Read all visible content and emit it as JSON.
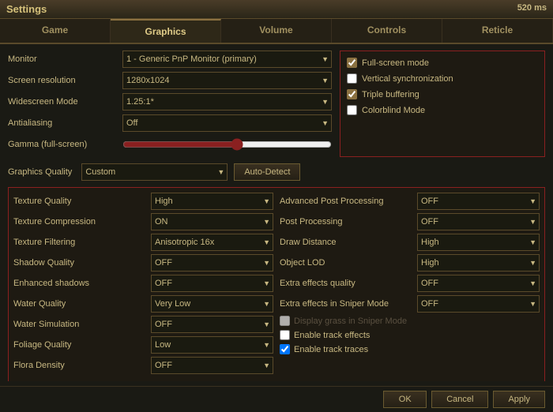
{
  "titleBar": {
    "label": "Settings"
  },
  "fpscounter": "520 ms",
  "tabs": [
    {
      "id": "game",
      "label": "Game",
      "active": false
    },
    {
      "id": "graphics",
      "label": "Graphics",
      "active": true
    },
    {
      "id": "volume",
      "label": "Volume",
      "active": false
    },
    {
      "id": "controls",
      "label": "Controls",
      "active": false
    },
    {
      "id": "reticle",
      "label": "Reticle",
      "active": false
    }
  ],
  "leftSettings": {
    "monitor": {
      "label": "Monitor",
      "value": "1 - Generic PnP Monitor (primary)"
    },
    "screenResolution": {
      "label": "Screen resolution",
      "value": "1280x1024"
    },
    "widescreenMode": {
      "label": "Widescreen Mode",
      "value": "1.25:1*"
    },
    "antialiasing": {
      "label": "Antialiasing",
      "value": "Off"
    },
    "gamma": {
      "label": "Gamma (full-screen)",
      "sliderValue": 55
    }
  },
  "rightPanel": {
    "fullScreenMode": {
      "label": "Full-screen mode",
      "checked": true
    },
    "verticalSync": {
      "label": "Vertical synchronization",
      "checked": false
    },
    "tripleBuffering": {
      "label": "Triple buffering",
      "checked": true
    },
    "colorblindMode": {
      "label": "Colorblind Mode",
      "checked": false
    }
  },
  "graphicsQuality": {
    "label": "Graphics Quality",
    "value": "Custom",
    "autoDetect": "Auto-Detect"
  },
  "bottomLeft": {
    "items": [
      {
        "label": "Texture Quality",
        "value": "High"
      },
      {
        "label": "Texture Compression",
        "value": "ON"
      },
      {
        "label": "Texture Filtering",
        "value": "Anisotropic 16x"
      },
      {
        "label": "Shadow Quality",
        "value": "OFF"
      },
      {
        "label": "Enhanced shadows",
        "value": "OFF"
      },
      {
        "label": "Water Quality",
        "value": "Very Low"
      },
      {
        "label": "Water Simulation",
        "value": "OFF"
      },
      {
        "label": "Foliage Quality",
        "value": "Low"
      },
      {
        "label": "Flora Density",
        "value": "OFF"
      }
    ]
  },
  "bottomRight": {
    "dropdownItems": [
      {
        "label": "Advanced Post Processing",
        "value": "OFF"
      },
      {
        "label": "Post Processing",
        "value": "OFF"
      },
      {
        "label": "Draw Distance",
        "value": "High"
      },
      {
        "label": "Object LOD",
        "value": "High"
      },
      {
        "label": "Extra effects quality",
        "value": "OFF"
      },
      {
        "label": "Extra effects in Sniper Mode",
        "value": "OFF"
      }
    ],
    "checkboxItems": [
      {
        "label": "Display grass in Sniper Mode",
        "checked": false,
        "disabled": true
      },
      {
        "label": "Enable track effects",
        "checked": false,
        "disabled": false
      },
      {
        "label": "Enable track traces",
        "checked": true,
        "disabled": false
      }
    ]
  },
  "footer": {
    "ok": "OK",
    "cancel": "Cancel",
    "apply": "Apply"
  }
}
